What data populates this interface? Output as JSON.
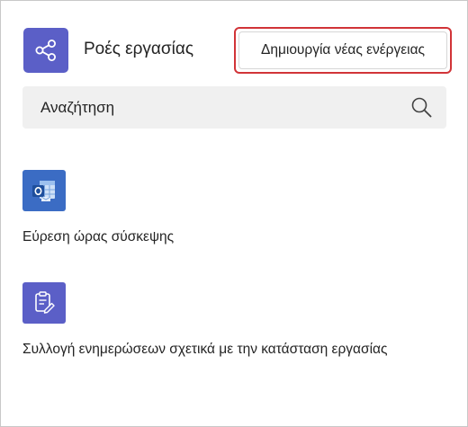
{
  "header": {
    "app_icon": "share-nodes-icon",
    "title": "Ροές εργασίας",
    "create_button_label": "Δημιουργία νέας ενέργειας"
  },
  "search": {
    "placeholder": "Αναζήτηση",
    "icon": "search-icon"
  },
  "flows": [
    {
      "label": "Εύρεση ώρας σύσκεψης",
      "icon": "outlook-calendar-icon",
      "color": "#3b6cc4"
    },
    {
      "label": "Συλλογή ενημερώσεων σχετικά με την κατάσταση εργασίας",
      "icon": "clipboard-edit-icon",
      "color": "#5b5fc7"
    }
  ],
  "colors": {
    "accent": "#5b5fc7",
    "highlight": "#d13438",
    "search_bg": "#f0f0f0"
  }
}
